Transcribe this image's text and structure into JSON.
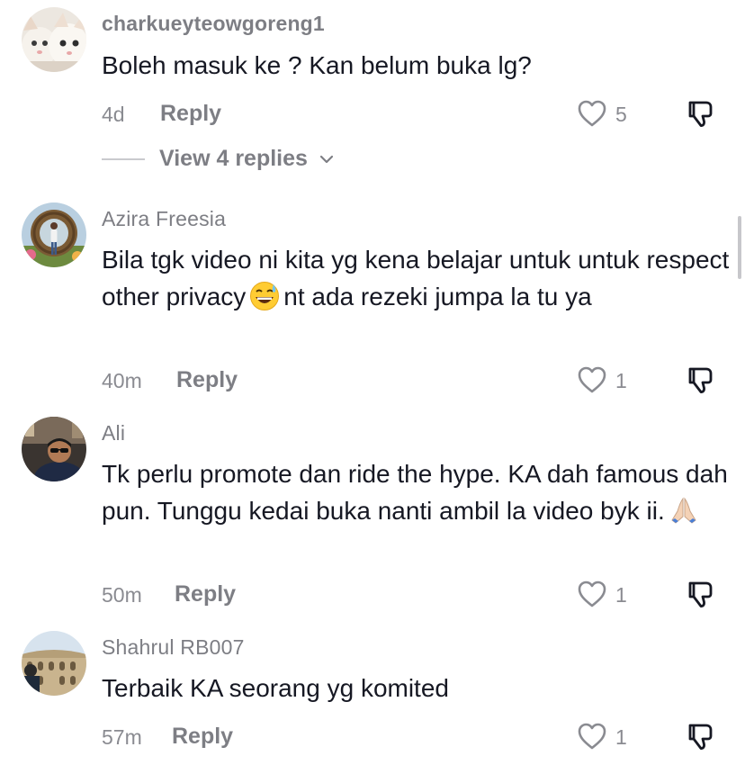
{
  "comments": [
    {
      "username": "charkueyteowgoreng1",
      "text": "Boleh masuk ke ? Kan belum buka lg?",
      "time": "4d",
      "reply_label": "Reply",
      "likes": "5",
      "avatar": "cats-photo"
    },
    {
      "username": "Azira Freesia",
      "text_before": "Bila tgk video ni kita yg kena belajar untuk untuk respect other privacy",
      "emoji": "grinning-sweat-emoji",
      "text_after": "nt ada rezeki jumpa la tu ya",
      "time": "40m",
      "reply_label": "Reply",
      "likes": "1",
      "avatar": "woman-in-garden-photo"
    },
    {
      "username": "Ali",
      "text_before": "Tk perlu promote dan ride the hype. KA dah famous dah pun. Tunggu kedai buka nanti ambil la video byk ii.",
      "emoji": "folded-hands-emoji",
      "time": "50m",
      "reply_label": "Reply",
      "likes": "1",
      "avatar": "man-with-sunglasses-photo"
    },
    {
      "username": "Shahrul RB007",
      "text": "Terbaik KA seorang yg komited",
      "time": "57m",
      "reply_label": "Reply",
      "likes": "1",
      "avatar": "colosseum-photo"
    }
  ],
  "view_replies": {
    "label": "View 4 replies"
  },
  "icons": {
    "like": "heart-outline-icon",
    "dislike": "thumbs-down-icon",
    "expand": "chevron-down-icon"
  },
  "colors": {
    "text": "#161823",
    "secondary": "#7d7e84",
    "background": "#ffffff"
  }
}
